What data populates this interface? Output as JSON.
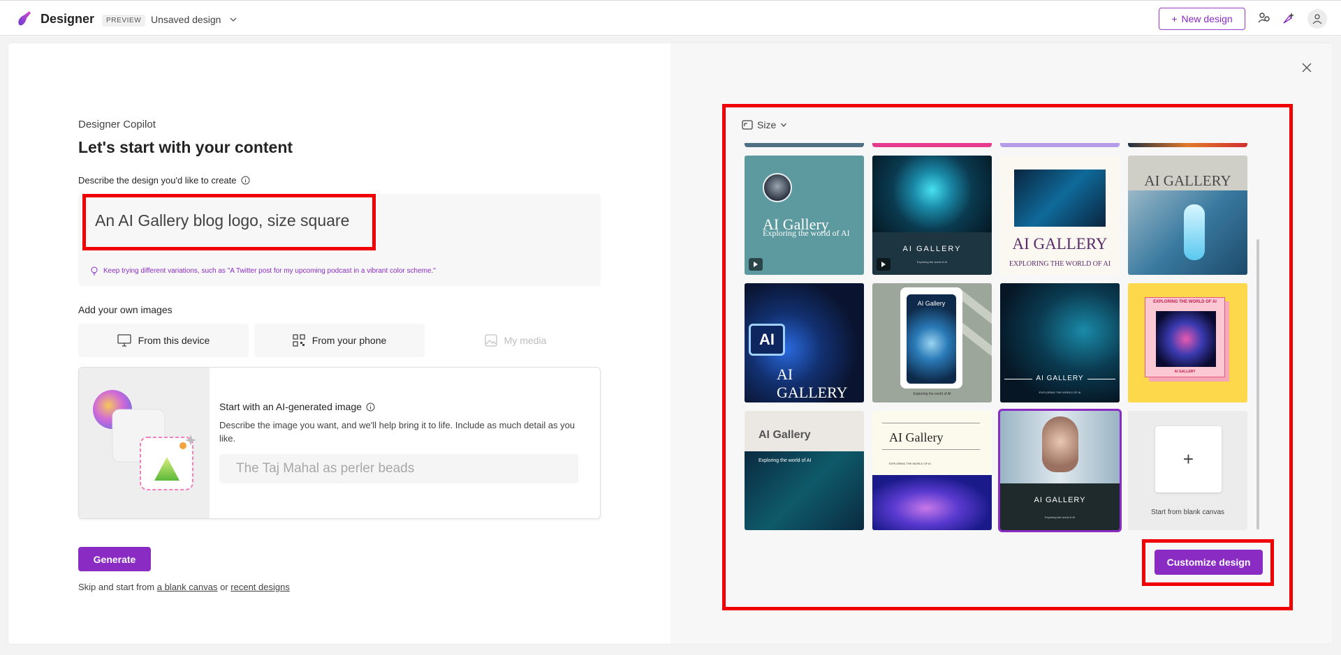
{
  "header": {
    "app_name": "Designer",
    "badge": "PREVIEW",
    "doc_name": "Unsaved design",
    "new_design_label": "New design",
    "accent_color": "#8a2bc4"
  },
  "copilot": {
    "label": "Designer Copilot",
    "heading": "Let's start with your content",
    "describe_label": "Describe the design you'd like to create",
    "prompt_value": "An AI Gallery blog logo, size square",
    "hint": "Keep trying different variations, such as \"A Twitter post for my upcoming podcast in a vibrant color scheme.\""
  },
  "images": {
    "label": "Add your own images",
    "from_device": "From this device",
    "from_phone": "From your phone",
    "my_media": "My media"
  },
  "ai_image": {
    "title": "Start with an AI-generated image",
    "description": "Describe the image you want, and we'll help bring it to life. Include as much detail as you like.",
    "placeholder": "The Taj Mahal as perler beads"
  },
  "actions": {
    "generate": "Generate",
    "skip_prefix": "Skip and start from",
    "blank_canvas_link": "a blank canvas",
    "or": "or",
    "recent_designs_link": "recent designs"
  },
  "gallery": {
    "size_label": "Size",
    "tiles": [
      {
        "title": "AI Gallery",
        "subtitle": "Exploring the world of AI"
      },
      {
        "title": "AI GALLERY",
        "subtitle": "Exploring the world of AI"
      },
      {
        "title": "AI GALLERY",
        "subtitle": "EXPLORING THE WORLD OF AI"
      },
      {
        "title": "AI GALLERY",
        "subtitle": ""
      },
      {
        "title": "AI GALLERY",
        "subtitle": "AI"
      },
      {
        "title": "AI Gallery",
        "subtitle": "Exploring the world of AI"
      },
      {
        "title": "AI GALLERY",
        "subtitle": "EXPLORING THE WORLD OF AI"
      },
      {
        "title": "AI GALLERY",
        "subtitle": "EXPLORING THE WORLD OF AI"
      },
      {
        "title": "AI Gallery",
        "subtitle": "Exploring the world of AI"
      },
      {
        "title": "AI Gallery",
        "subtitle": "EXPLORING THE WORLD OF AI"
      },
      {
        "title": "AI GALLERY",
        "subtitle": "Exploring the world of AI"
      }
    ],
    "blank_label": "Start from blank canvas",
    "customize_label": "Customize design"
  }
}
